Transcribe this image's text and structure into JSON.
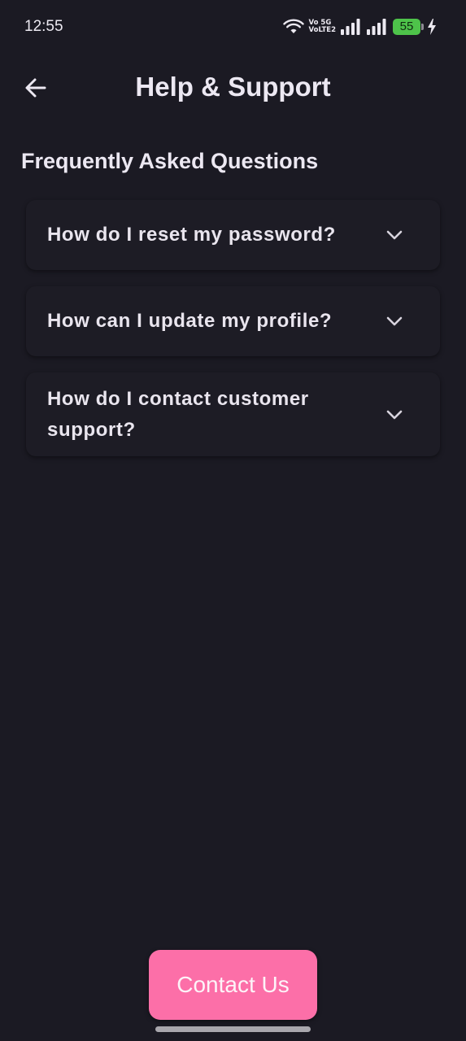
{
  "status_bar": {
    "time": "12:55",
    "volte_top": "Vo 5G",
    "volte_bottom": "VoLTE2",
    "battery_level": "55",
    "battery_color": "#4ec34a"
  },
  "header": {
    "title": "Help & Support",
    "back_icon": "arrow-left-icon"
  },
  "faq": {
    "section_title": "Frequently Asked Questions",
    "items": [
      {
        "question": "How do I reset my password?",
        "icon": "chevron-down-icon"
      },
      {
        "question": "How can I update my profile?",
        "icon": "chevron-down-icon"
      },
      {
        "question": "How do I contact customer support?",
        "icon": "chevron-down-icon"
      }
    ]
  },
  "contact": {
    "label": "Contact Us",
    "color": "#fc6fa8"
  }
}
